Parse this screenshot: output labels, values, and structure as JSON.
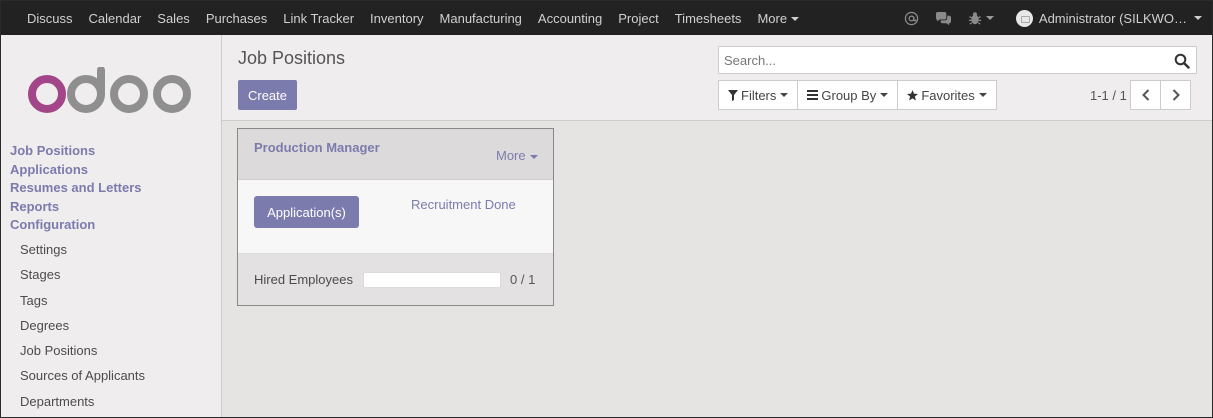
{
  "topbar": {
    "menu": [
      "Discuss",
      "Calendar",
      "Sales",
      "Purchases",
      "Link Tracker",
      "Inventory",
      "Manufacturing",
      "Accounting",
      "Project",
      "Timesheets"
    ],
    "more_label": "More",
    "user_name": "Administrator (SILKWO…"
  },
  "sidebar": {
    "headers": [
      "Job Positions",
      "Applications",
      "Resumes and Letters",
      "Reports",
      "Configuration"
    ],
    "config_items": [
      "Settings",
      "Stages",
      "Tags",
      "Degrees",
      "Job Positions",
      "Sources of Applicants",
      "Departments"
    ]
  },
  "control_panel": {
    "title": "Job Positions",
    "create_label": "Create",
    "search_placeholder": "Search...",
    "filters_label": "Filters",
    "group_by_label": "Group By",
    "favorites_label": "Favorites",
    "pager": "1-1 / 1"
  },
  "card": {
    "title": "Production Manager",
    "more_label": "More",
    "applications_label": "Application(s)",
    "recruitment_label": "Recruitment Done",
    "hired_label": "Hired Employees",
    "hired_progress": 0,
    "hired_text": "0 / 1"
  },
  "colors": {
    "accent": "#7c7bad",
    "navbar": "#222222",
    "background": "#e6e3e3"
  }
}
